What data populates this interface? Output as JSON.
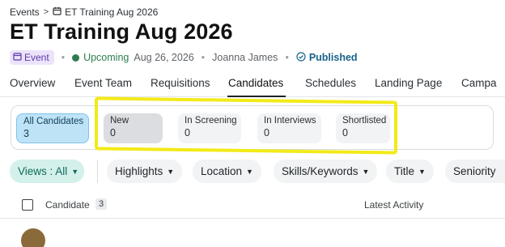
{
  "breadcrumb": {
    "parent": "Events",
    "separator": ">",
    "current": "ET Training Aug 2026"
  },
  "page": {
    "title": "ET Training Aug 2026"
  },
  "meta": {
    "type_badge": "Event",
    "status": "Upcoming",
    "date": "Aug 26, 2026",
    "owner": "Joanna James",
    "publish_state": "Published",
    "dot_separator": "•"
  },
  "tabs": [
    "Overview",
    "Event Team",
    "Requisitions",
    "Candidates",
    "Schedules",
    "Landing Page",
    "Campa"
  ],
  "active_tab": "Candidates",
  "stages": [
    {
      "label": "All Candidates",
      "count": "3"
    },
    {
      "label": "New",
      "count": "0"
    },
    {
      "label": "In Screening",
      "count": "0"
    },
    {
      "label": "In Interviews",
      "count": "0"
    },
    {
      "label": "Shortlisted",
      "count": "0"
    }
  ],
  "filters": {
    "views": "Views : All",
    "highlights": "Highlights",
    "location": "Location",
    "skills": "Skills/Keywords",
    "title": "Title",
    "seniority": "Seniority"
  },
  "table": {
    "col_candidate": "Candidate",
    "candidate_count": "3",
    "col_activity": "Latest Activity"
  },
  "colors": {
    "accent": "#2e7d4f",
    "highlight": "#f2ea18",
    "selected_stage": "#bfe3f6",
    "views_chip": "#d4f0eb"
  },
  "icons": {
    "breadcrumb_icon": "calendar-icon",
    "event_icon": "calendar-icon",
    "publish_icon": "check-circle-icon",
    "chevron": "chevron-down-icon"
  }
}
